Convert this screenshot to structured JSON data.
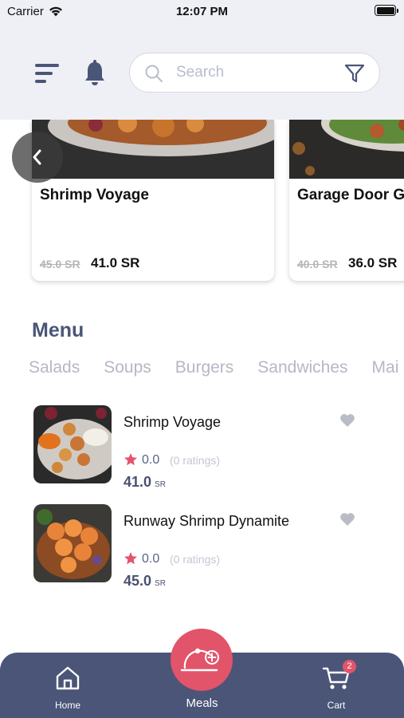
{
  "status_bar": {
    "carrier": "Carrier",
    "time": "12:07 PM"
  },
  "header": {
    "search_placeholder": "Search",
    "icons": [
      "menu-icon",
      "bell-icon",
      "search-icon",
      "filter-icon"
    ]
  },
  "offers": [
    {
      "name": "Shrimp Voyage",
      "old_price": "45.0 SR",
      "new_price": "41.0 SR"
    },
    {
      "name": "Garage Door G",
      "old_price": "40.0 SR",
      "new_price": "36.0 SR"
    }
  ],
  "menu": {
    "title": "Menu",
    "categories": [
      "Salads",
      "Soups",
      "Burgers",
      "Sandwiches",
      "Mai"
    ],
    "items": [
      {
        "name": "Shrimp Voyage",
        "rating": "0.0",
        "ratings_count": "(0 ratings)",
        "price": "41.0",
        "currency": "SR"
      },
      {
        "name": "Runway Shrimp Dynamite",
        "rating": "0.0",
        "ratings_count": "(0 ratings)",
        "price": "45.0",
        "currency": "SR"
      }
    ]
  },
  "tabbar": {
    "home_label": "Home",
    "meals_label": "Meals",
    "cart_label": "Cart",
    "cart_badge": "2"
  },
  "colors": {
    "accent": "#e2546a",
    "nav": "#4a5578",
    "header_bg": "#eef0f6"
  }
}
